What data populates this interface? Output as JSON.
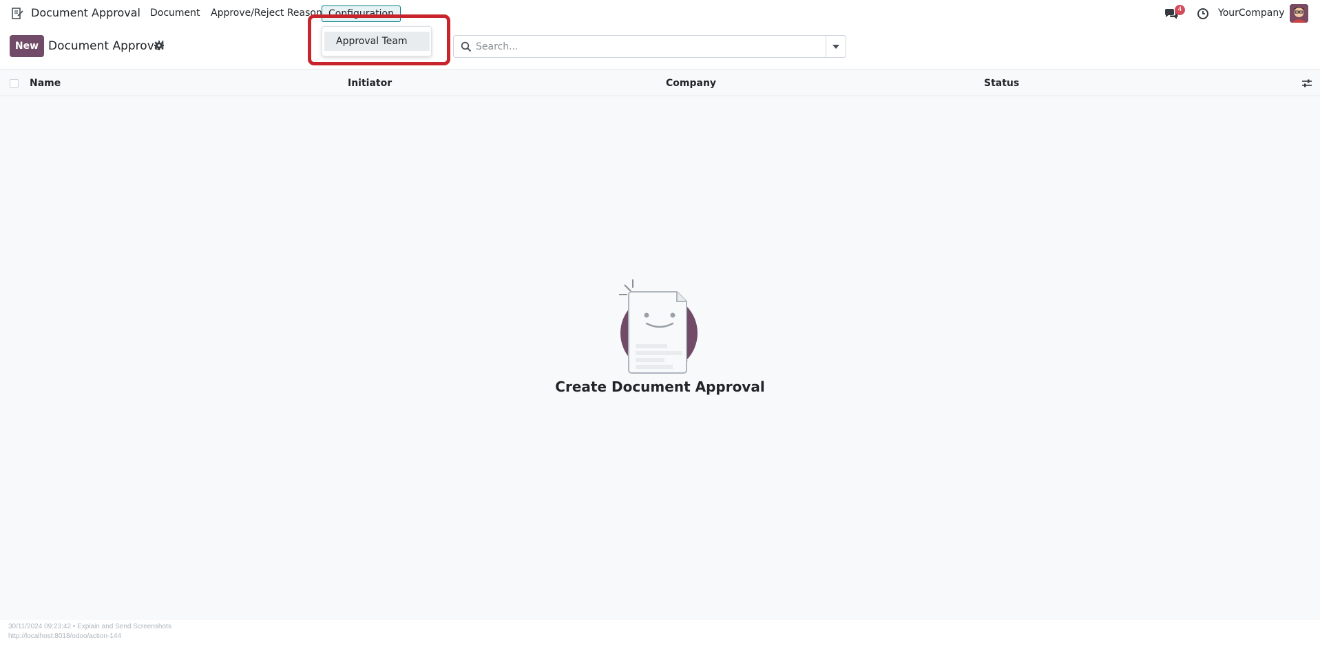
{
  "navbar": {
    "app_name": "Document Approval",
    "menu": {
      "document": "Document",
      "approve_reject": "Approve/Reject Reason",
      "configuration": "Configuration"
    },
    "chat_badge": "4",
    "company": "YourCompany"
  },
  "dropdown": {
    "items": [
      "Approval Team"
    ]
  },
  "control": {
    "new_label": "New",
    "title": "Document Approval",
    "search_placeholder": "Search..."
  },
  "list": {
    "columns": [
      "Name",
      "Initiator",
      "Company",
      "Status"
    ]
  },
  "empty_state": {
    "title": "Create Document Approval"
  },
  "footer": {
    "line1": "30/11/2024 09:23:42 • Explain and Send Screenshots",
    "line2": "http://localhost:8018/odoo/action-144"
  },
  "colors": {
    "brand": "#714b67",
    "highlight": "#c8242c",
    "badge": "#d44c59",
    "active_menu_border": "#017e84"
  },
  "icons": [
    "app-icon",
    "chat-icon",
    "clock-icon",
    "gear-icon",
    "search-icon",
    "chevron-down-icon",
    "settings-sliders-icon"
  ]
}
